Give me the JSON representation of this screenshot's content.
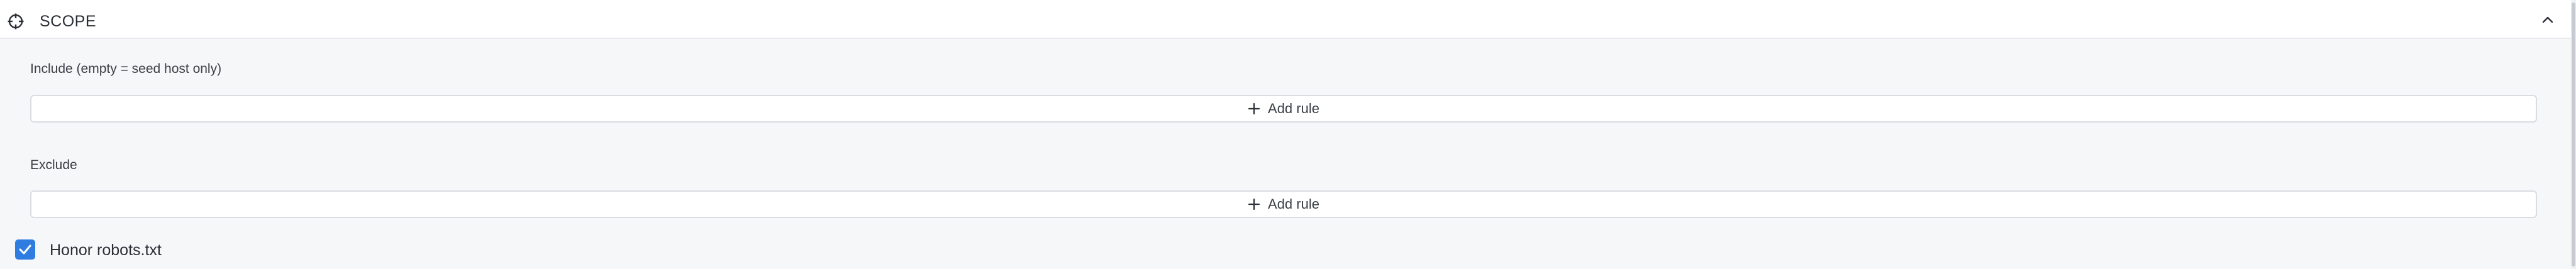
{
  "section": {
    "title": "SCOPE",
    "icon": "crosshair-icon",
    "collapse_icon": "chevron-up-icon",
    "expanded": true
  },
  "include": {
    "label": "Include (empty = seed host only)",
    "add_rule_label": "Add rule",
    "add_icon": "plus-icon"
  },
  "exclude": {
    "label": "Exclude",
    "add_rule_label": "Add rule",
    "add_icon": "plus-icon"
  },
  "robots": {
    "label": "Honor robots.txt",
    "checked": true
  },
  "colors": {
    "accent": "#2f7de1",
    "background": "#f6f7f9",
    "header_background": "#ffffff",
    "border": "#d9dce1"
  }
}
